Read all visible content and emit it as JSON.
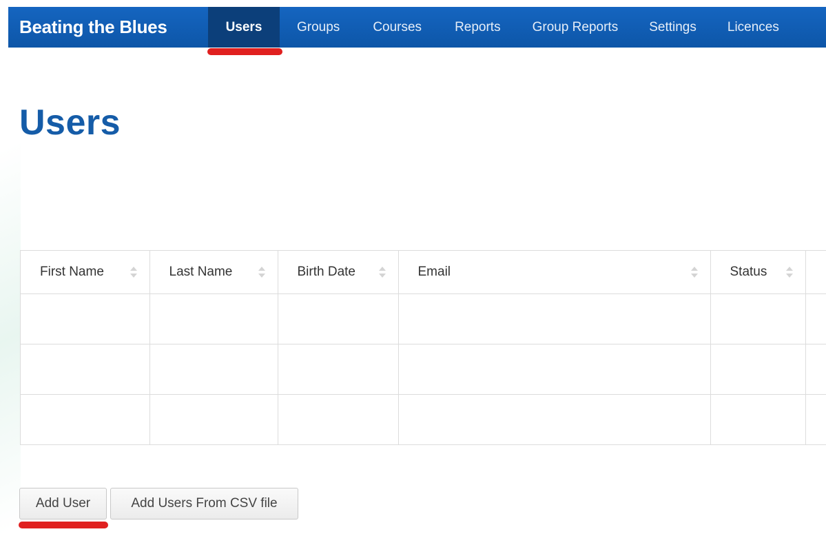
{
  "navbar": {
    "brand": "Beating the Blues",
    "items": [
      {
        "label": "Users",
        "active": true
      },
      {
        "label": "Groups",
        "active": false
      },
      {
        "label": "Courses",
        "active": false
      },
      {
        "label": "Reports",
        "active": false
      },
      {
        "label": "Group Reports",
        "active": false
      },
      {
        "label": "Settings",
        "active": false
      },
      {
        "label": "Licences",
        "active": false
      }
    ]
  },
  "page": {
    "title": "Users"
  },
  "table": {
    "columns": [
      "First Name",
      "Last Name",
      "Birth Date",
      "Email",
      "Status"
    ],
    "row_count": 3
  },
  "actions": {
    "add_user": "Add User",
    "add_csv": "Add Users From CSV file"
  },
  "colors": {
    "navbar": "#1565c0",
    "navbar_active": "#0c3f7a",
    "title": "#155ca8",
    "highlight": "#e0201f"
  }
}
